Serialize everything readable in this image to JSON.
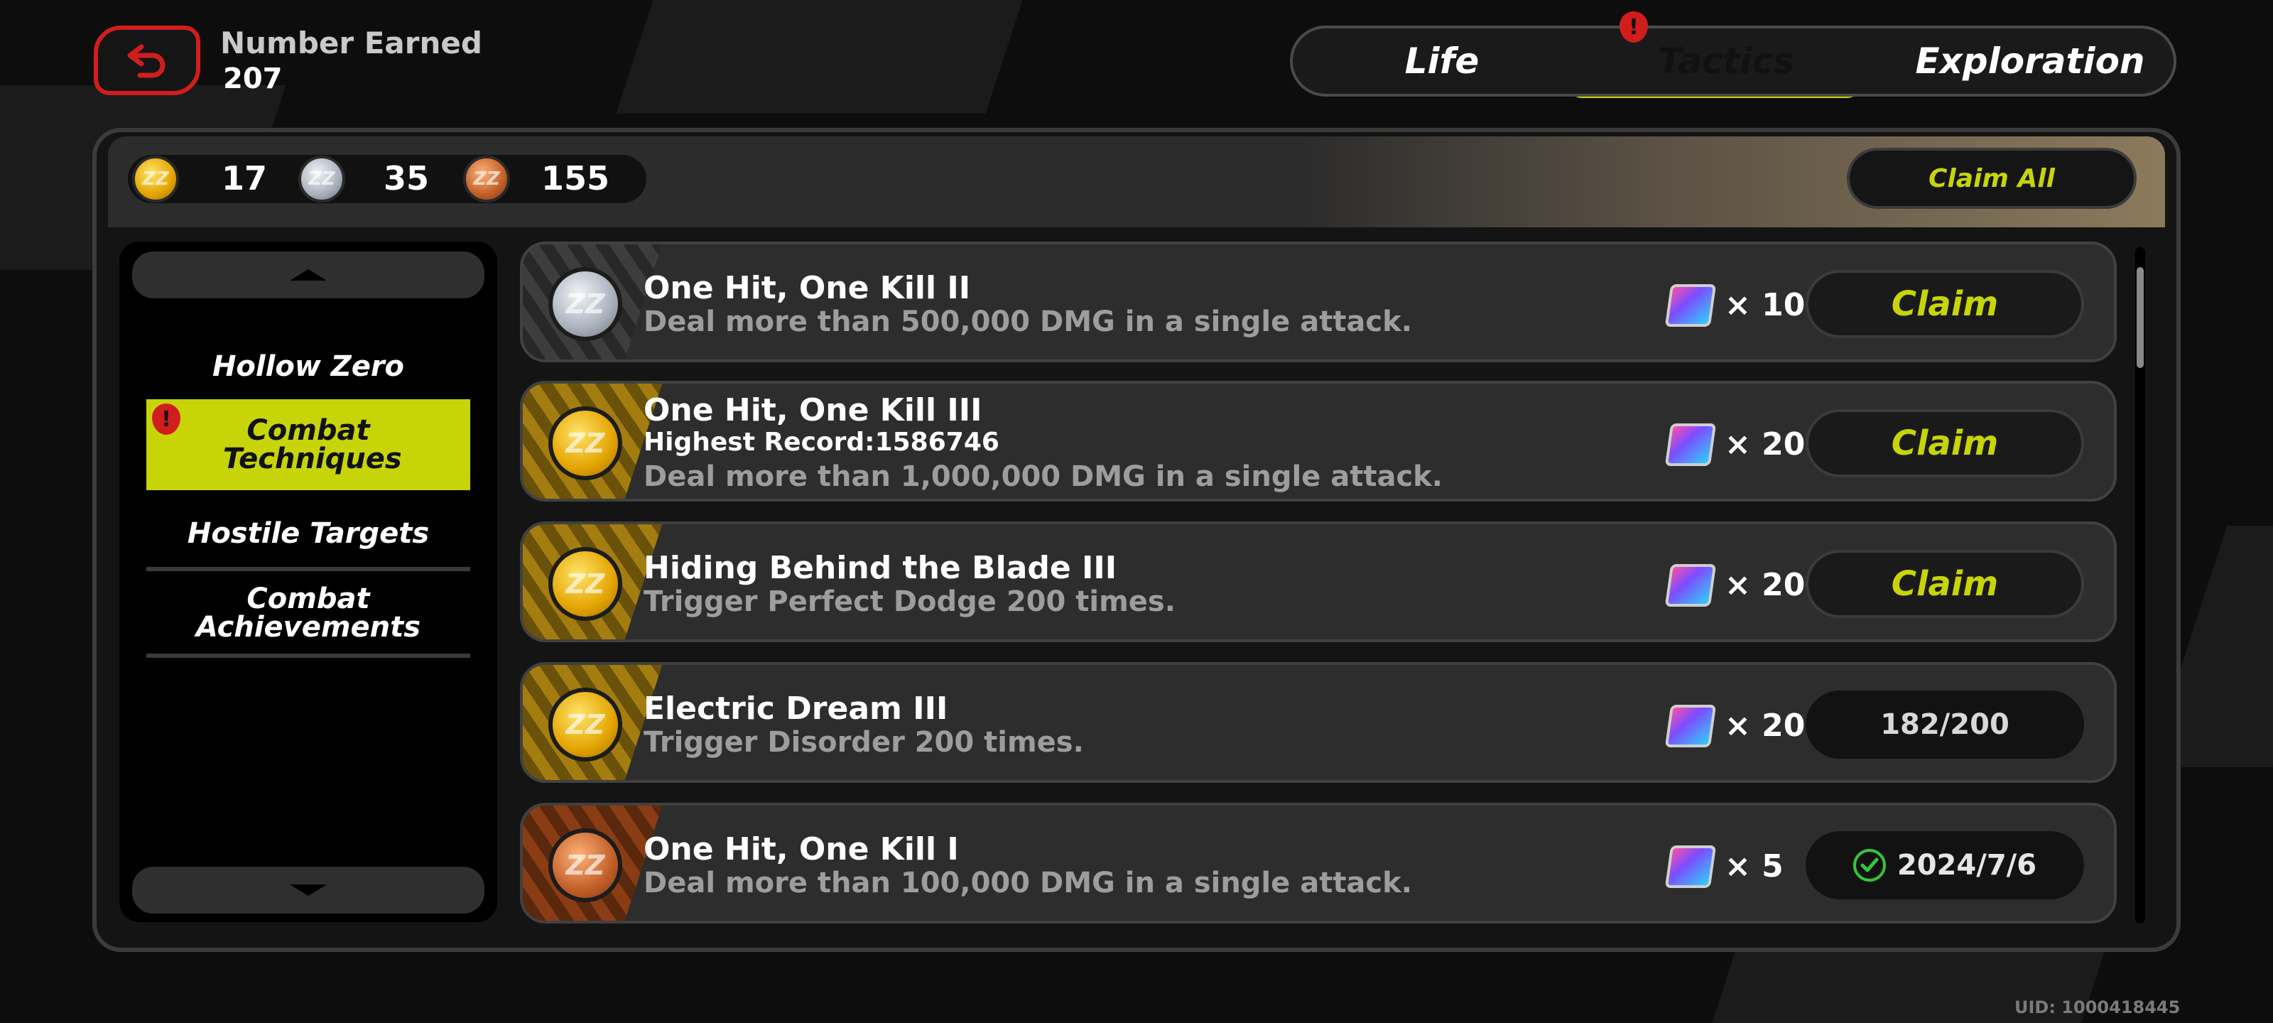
{
  "header": {
    "back_icon": "return-arrow-icon",
    "earned_label": "Number Earned",
    "earned_value": "207"
  },
  "tabs": [
    {
      "label": "Life",
      "active": false
    },
    {
      "label": "Tactics",
      "active": true,
      "alert": true
    },
    {
      "label": "Exploration",
      "active": false
    }
  ],
  "currency": {
    "gold": "17",
    "silver": "35",
    "bronze": "155"
  },
  "claim_all_label": "Claim All",
  "sidebar": {
    "items": [
      {
        "label": "Hollow Zero",
        "active": false
      },
      {
        "label": "Combat Techniques",
        "active": true,
        "alert": true
      },
      {
        "label": "Hostile Targets",
        "active": false
      },
      {
        "label": "Combat Achievements",
        "active": false
      }
    ]
  },
  "achievements": [
    {
      "tier": "silver",
      "title": "One Hit, One Kill II",
      "description": "Deal more than 500,000 DMG in a single attack.",
      "reward_qty": "× 10",
      "action": "Claim"
    },
    {
      "tier": "gold",
      "title": "One Hit, One Kill III",
      "record": "Highest Record:1586746",
      "description": "Deal more than 1,000,000 DMG in a single attack.",
      "reward_qty": "× 20",
      "action": "Claim"
    },
    {
      "tier": "gold",
      "title": "Hiding Behind the Blade III",
      "description": "Trigger Perfect Dodge 200 times.",
      "reward_qty": "× 20",
      "action": "Claim"
    },
    {
      "tier": "gold",
      "title": "Electric Dream III",
      "description": "Trigger Disorder 200 times.",
      "reward_qty": "× 20",
      "progress": "182/200"
    },
    {
      "tier": "bronze",
      "title": "One Hit, One Kill I",
      "description": "Deal more than 100,000 DMG in a single attack.",
      "reward_qty": "× 5",
      "completed_date": "2024/7/6"
    }
  ],
  "uid": "UID: 1000418445",
  "colors": {
    "accent": "#c7d408",
    "alert": "#d21d1d",
    "panel": "#141414",
    "card": "#2d2d2d"
  }
}
